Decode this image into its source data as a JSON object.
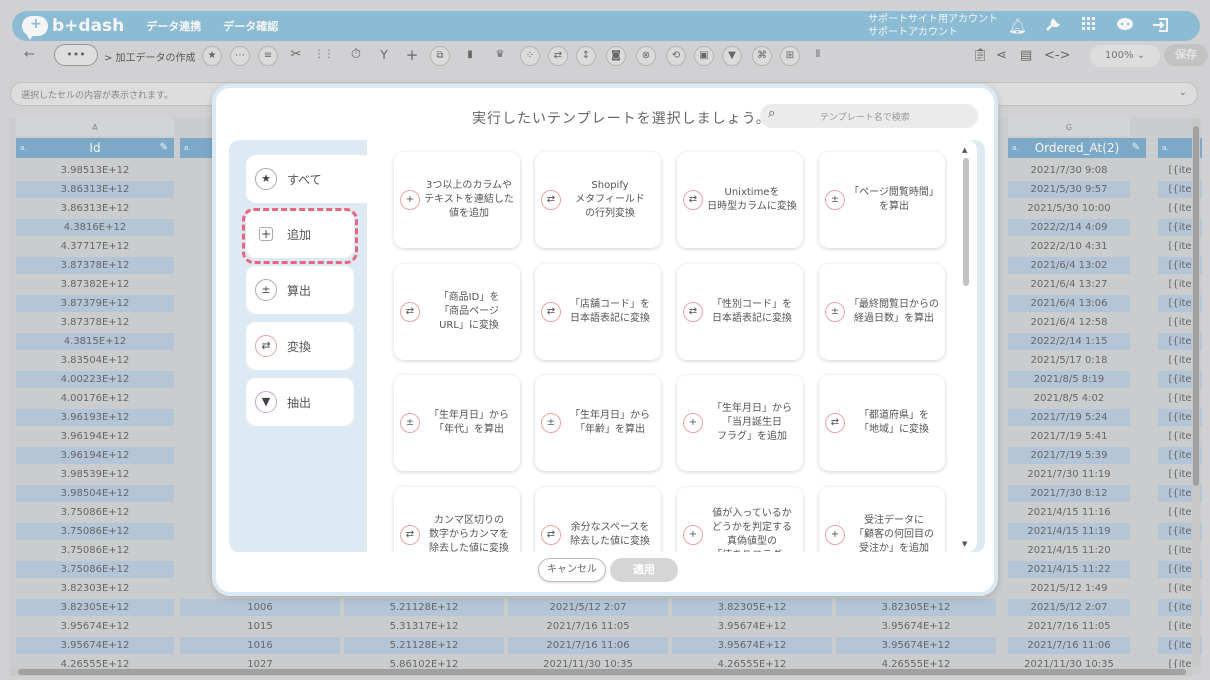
{
  "app": {
    "logo_text": "b+dash",
    "nav": [
      "データ連携",
      "データ確認"
    ],
    "account_line1": "サポートサイト用アカウント",
    "account_line2": "サポートアカウント"
  },
  "toolbar": {
    "back": "←",
    "more": "•••",
    "breadcrumb": "> 加工データの作成",
    "zoom": "100%",
    "zoom_chevron": "⌄",
    "save": "保存"
  },
  "cellbar": {
    "placeholder": "選択したセルの内容が表示されます。"
  },
  "grid": {
    "letters": [
      "A",
      "G"
    ],
    "headers": [
      "Id",
      "Ordered_At(2)"
    ],
    "header_tag": "a.",
    "col_a": [
      "3.98513E+12",
      "3.86313E+12",
      "3.86313E+12",
      "4.3816E+12",
      "4.37717E+12",
      "3.87378E+12",
      "3.87382E+12",
      "3.87379E+12",
      "3.87378E+12",
      "4.3815E+12",
      "3.83504E+12",
      "4.00223E+12",
      "4.00176E+12",
      "3.96193E+12",
      "3.96194E+12",
      "3.96194E+12",
      "3.98539E+12",
      "3.98504E+12",
      "3.75086E+12",
      "3.75086E+12",
      "3.75086E+12",
      "3.75086E+12",
      "3.82303E+12",
      "3.82305E+12",
      "3.95674E+12",
      "3.95674E+12",
      "4.26555E+12"
    ],
    "col_g": [
      "2021/7/30 9:08",
      "2021/5/30 9:57",
      "2021/5/30 10:00",
      "2022/2/14 4:09",
      "2022/2/10 4:31",
      "2021/6/4 13:02",
      "2021/6/4 13:27",
      "2021/6/4 13:06",
      "2021/6/4 12:58",
      "2022/2/14 1:15",
      "2021/5/17 0:18",
      "2021/8/5 8:19",
      "2021/8/5 4:02",
      "2021/7/19 5:24",
      "2021/7/19 5:41",
      "2021/7/19 5:39",
      "2021/7/30 11:19",
      "2021/7/30 8:12",
      "2021/4/15 11:16",
      "2021/4/15 11:19",
      "2021/4/15 11:20",
      "2021/4/15 11:22",
      "2021/5/12 1:49",
      "2021/5/12 2:07",
      "2021/7/16 11:05",
      "2021/7/16 11:06",
      "2021/11/30 10:35"
    ],
    "col_h_partial": "[{ite",
    "bottom_rows": [
      [
        "1006",
        "5.21128E+12",
        "2021/5/12 2:07",
        "3.82305E+12",
        "3.82305E+12"
      ],
      [
        "1015",
        "5.31317E+12",
        "2021/7/16 11:05",
        "3.95674E+12",
        "3.95674E+12"
      ],
      [
        "1016",
        "5.21128E+12",
        "2021/7/16 11:06",
        "3.95674E+12",
        "3.95674E+12"
      ],
      [
        "1027",
        "5.86102E+12",
        "2021/11/30 10:35",
        "4.26555E+12",
        "4.26555E+12"
      ]
    ]
  },
  "modal": {
    "title": "実行したいテンプレートを選択しましょう。",
    "search_placeholder": "テンプレート名で検索",
    "categories": [
      {
        "label": "すべて",
        "icon": "★"
      },
      {
        "label": "追加",
        "icon": "+"
      },
      {
        "label": "算出",
        "icon": "±"
      },
      {
        "label": "変換",
        "icon": "⇄"
      },
      {
        "label": "抽出",
        "icon": "▼"
      }
    ],
    "cards": [
      {
        "text": "3つ以上のカラムや\nテキストを連結した\n値を追加",
        "icon": "+"
      },
      {
        "text": "Shopify\nメタフィールド\nの行列変換",
        "icon": "⇄"
      },
      {
        "text": "Unixtimeを\n日時型カラムに変換",
        "icon": "⇄"
      },
      {
        "text": "「ページ閲覧時間」\nを算出",
        "icon": "±"
      },
      {
        "text": "「商品ID」を\n「商品ページ\nURL」に変換",
        "icon": "⇄"
      },
      {
        "text": "「店舗コード」を\n日本語表記に変換",
        "icon": "⇄"
      },
      {
        "text": "「性別コード」を\n日本語表記に変換",
        "icon": "⇄"
      },
      {
        "text": "「最終閲覧日からの\n経過日数」を算出",
        "icon": "±"
      },
      {
        "text": "「生年月日」から\n「年代」を算出",
        "icon": "±"
      },
      {
        "text": "「生年月日」から\n「年齢」を算出",
        "icon": "±"
      },
      {
        "text": "「生年月日」から\n「当月誕生日\nフラグ」を追加",
        "icon": "+"
      },
      {
        "text": "「都道府県」を\n「地域」に変換",
        "icon": "⇄"
      },
      {
        "text": "カンマ区切りの\n数字からカンマを\n除去した値に変換",
        "icon": "⇄"
      },
      {
        "text": "余分なスペースを\n除去した値に変換",
        "icon": "⇄"
      },
      {
        "text": "値が入っているか\nどうかを判定する\n真偽値型の\n「値ありフラグ」",
        "icon": "+"
      },
      {
        "text": "受注データに\n「顧客の何回目の\n受注か」を追加",
        "icon": "+"
      }
    ],
    "cancel": "キャンセル",
    "apply": "適用"
  }
}
